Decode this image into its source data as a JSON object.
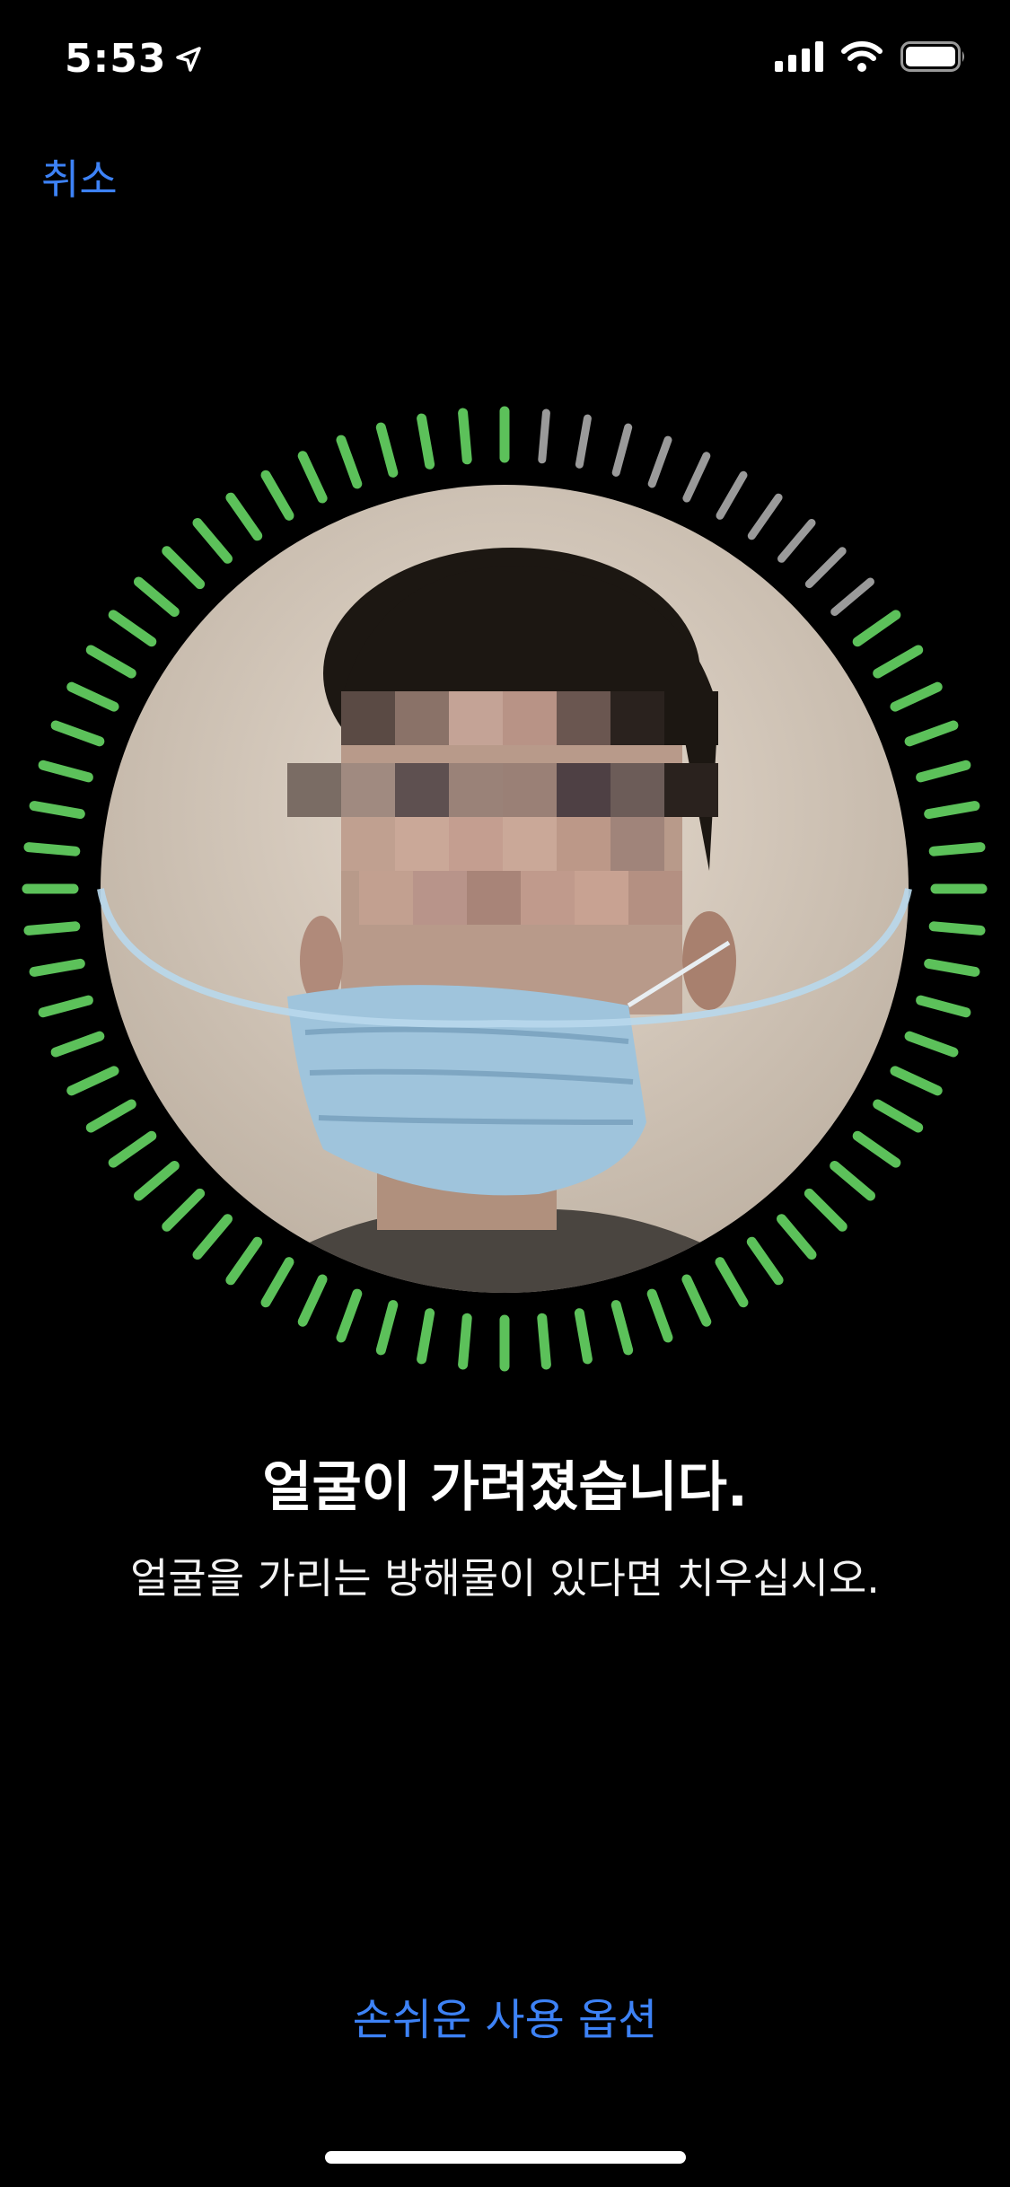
{
  "status_bar": {
    "time": "5:53",
    "location_icon": "location-arrow-icon",
    "signal_icon": "cellular-signal-icon",
    "wifi_icon": "wifi-icon",
    "battery_icon": "battery-icon"
  },
  "nav": {
    "cancel_label": "취소"
  },
  "face_scan": {
    "progress_color": "#5cc15a",
    "pending_color": "#9a9a9a",
    "tick_count": 72,
    "progress_fraction": 0.86
  },
  "message": {
    "title": "얼굴이 가려졌습니다.",
    "subtitle": "얼굴을 가리는 방해물이 있다면 치우십시오."
  },
  "footer": {
    "accessibility_label": "손쉬운 사용 옵션"
  },
  "colors": {
    "background": "#000000",
    "accent": "#3d82f6",
    "text": "#ffffff"
  }
}
